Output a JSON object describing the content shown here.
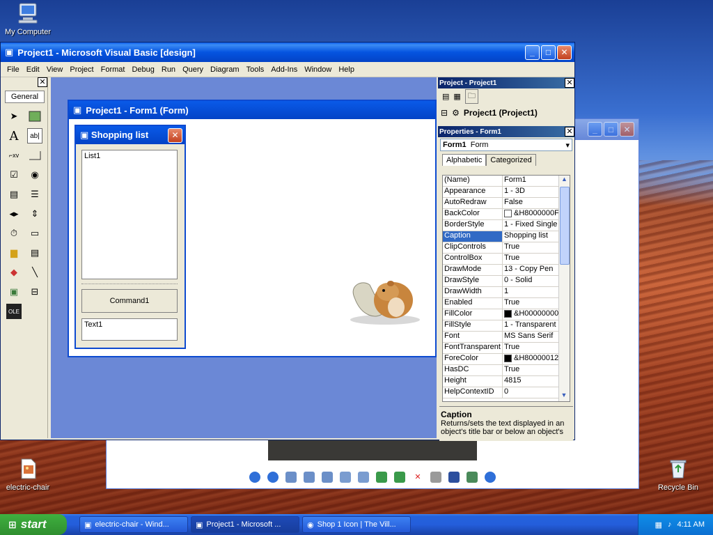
{
  "desktop": {
    "icons": [
      {
        "label": "My Computer",
        "icon": "computer-icon"
      },
      {
        "label": "electric-chair",
        "icon": "image-file-icon"
      },
      {
        "label": "Recycle Bin",
        "icon": "recycle-bin-icon"
      }
    ]
  },
  "vb": {
    "title": "Project1 - Microsoft Visual Basic [design]",
    "menus": [
      "File",
      "Edit",
      "View",
      "Project",
      "Format",
      "Debug",
      "Run",
      "Query",
      "Diagram",
      "Tools",
      "Add-Ins",
      "Window",
      "Help"
    ],
    "toolbox_tab": "General",
    "form_title": "Project1 - Form1 (Form)",
    "shopping_title": "Shopping list",
    "list_label": "List1",
    "command_label": "Command1",
    "text_label": "Text1"
  },
  "project_pane": {
    "title": "Project - Project1",
    "tree_item": "Project1 (Project1)"
  },
  "properties_pane": {
    "title": "Properties - Form1",
    "object_name": "Form1",
    "object_type": "Form",
    "tab_alphabetic": "Alphabetic",
    "tab_categorized": "Categorized",
    "rows": [
      {
        "name": "(Name)",
        "value": "Form1"
      },
      {
        "name": "Appearance",
        "value": "1 - 3D"
      },
      {
        "name": "AutoRedraw",
        "value": "False"
      },
      {
        "name": "BackColor",
        "value": "&H8000000F",
        "swatch": "#ffffff"
      },
      {
        "name": "BorderStyle",
        "value": "1 - Fixed Single"
      },
      {
        "name": "Caption",
        "value": "Shopping list",
        "selected": true
      },
      {
        "name": "ClipControls",
        "value": "True"
      },
      {
        "name": "ControlBox",
        "value": "True"
      },
      {
        "name": "DrawMode",
        "value": "13 - Copy Pen"
      },
      {
        "name": "DrawStyle",
        "value": "0 - Solid"
      },
      {
        "name": "DrawWidth",
        "value": "1"
      },
      {
        "name": "Enabled",
        "value": "True"
      },
      {
        "name": "FillColor",
        "value": "&H00000000",
        "swatch": "#000000"
      },
      {
        "name": "FillStyle",
        "value": "1 - Transparent"
      },
      {
        "name": "Font",
        "value": "MS Sans Serif"
      },
      {
        "name": "FontTransparent",
        "value": "True"
      },
      {
        "name": "ForeColor",
        "value": "&H80000012",
        "swatch": "#000000"
      },
      {
        "name": "HasDC",
        "value": "True"
      },
      {
        "name": "Height",
        "value": "4815"
      },
      {
        "name": "HelpContextID",
        "value": "0"
      }
    ],
    "desc_title": "Caption",
    "desc_text": "Returns/sets the text displayed in an object's title bar or below an object's"
  },
  "taskbar": {
    "start_label": "start",
    "tasks": [
      "electric-chair - Wind...",
      "Project1 - Microsoft ...",
      "Shop 1 Icon | The Vill..."
    ],
    "time": "4:11 AM"
  },
  "colors": {
    "xp_blue": "#0343c6",
    "selection": "#316ac5",
    "design_bg": "#6b88d6"
  }
}
